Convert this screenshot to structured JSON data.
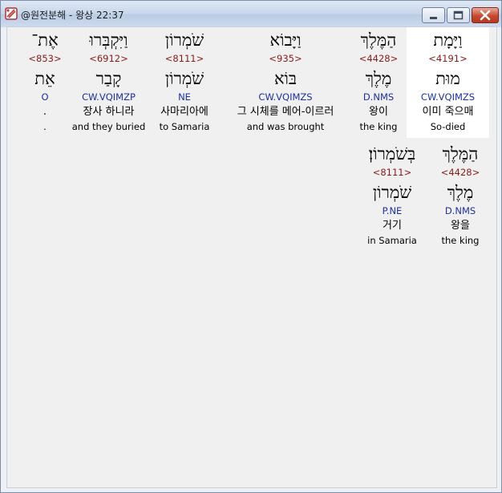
{
  "window": {
    "title": "@원전분해 - 왕상 22:37",
    "icons": {
      "app": "bible-analysis-app-icon",
      "minimize": "minimize-icon",
      "maximize": "maximize-icon",
      "close": "close-icon"
    }
  },
  "words": [
    {
      "heb": "וַיָּמָת",
      "strong": "<4191>",
      "lemma": "מוּת",
      "morph": "CW.VQIMZS",
      "kor": "이미 죽으매",
      "eng": "So-died"
    },
    {
      "heb": "הַמֶּלֶךְ",
      "strong": "<4428>",
      "lemma": "מֶלֶךְ",
      "morph": "D.NMS",
      "kor": "왕이",
      "eng": "the king"
    },
    {
      "heb": "וַיָּבוֹא",
      "strong": "<935>",
      "lemma": "בּוֹא",
      "morph": "CW.VQIMZS",
      "kor": "그 시체를 메어-이르러",
      "eng": "and was brought"
    },
    {
      "heb": "שֹׁמְרוֹן",
      "strong": "<8111>",
      "lemma": "שֹׁמְרוֹן",
      "morph": "NE",
      "kor": "사마리아에",
      "eng": "to Samaria"
    },
    {
      "heb": "וַיִּקְבְּרוּ",
      "strong": "<6912>",
      "lemma": "קָבַר",
      "morph": "CW.VQIMZP",
      "kor": "장사 하니라",
      "eng": "and they buried"
    },
    {
      "heb": "אֶת־",
      "strong": "<853>",
      "lemma": "אֵת",
      "morph": "O",
      "kor": ".",
      "eng": "."
    },
    {
      "heb": "הַמֶּלֶךְ",
      "strong": "<4428>",
      "lemma": "מֶלֶךְ",
      "morph": "D.NMS",
      "kor": "왕을",
      "eng": "the king"
    },
    {
      "heb": "בְּשֹׁמְרוֹן׃",
      "strong": "<8111>",
      "lemma": "שֹׁמְרוֹן",
      "morph": "P.NE",
      "kor": "거기",
      "eng": "in Samaria"
    }
  ]
}
